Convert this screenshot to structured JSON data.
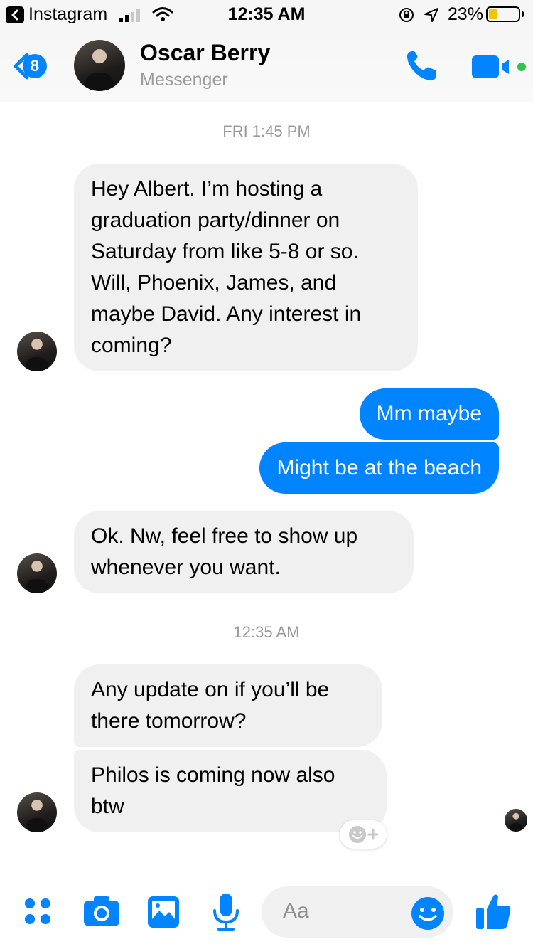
{
  "status_bar": {
    "back_app": "Instagram",
    "time": "12:35 AM",
    "battery": "23%",
    "battery_level": 0.23
  },
  "header": {
    "unread_count": "8",
    "contact_name": "Oscar Berry",
    "subtitle": "Messenger",
    "online": true
  },
  "thread": {
    "timestamps": [
      "FRI 1:45 PM",
      "12:35 AM"
    ],
    "messages": [
      {
        "sender": "Oscar Berry",
        "text": "Hey Albert. I’m hosting a graduation party/dinner on Saturday from like 5-8 or so. Will, Phoenix, James, and maybe David. Any interest in coming?"
      },
      {
        "sender": "me",
        "text": "Mm maybe"
      },
      {
        "sender": "me",
        "text": "Might be at the beach"
      },
      {
        "sender": "Oscar Berry",
        "text": "Ok. Nw, feel free to show up whenever you want."
      },
      {
        "sender": "Oscar Berry",
        "text": "Any update on if you’ll be there tomorrow?"
      },
      {
        "sender": "Oscar Berry",
        "text": "Philos is coming now also btw"
      }
    ]
  },
  "composer": {
    "placeholder": "Aa"
  },
  "colors": {
    "accent": "#0084ff",
    "incoming_bubble": "#f1f0f0",
    "online": "#31c24d",
    "battery": "#f5c400"
  },
  "icons": [
    "back-chevron-icon",
    "signal-icon",
    "wifi-icon",
    "orientation-lock-icon",
    "location-arrow-icon",
    "battery-icon",
    "phone-icon",
    "video-camera-icon",
    "add-reaction-icon",
    "apps-grid-icon",
    "camera-icon",
    "image-icon",
    "microphone-icon",
    "emoji-icon",
    "thumbs-up-icon"
  ]
}
